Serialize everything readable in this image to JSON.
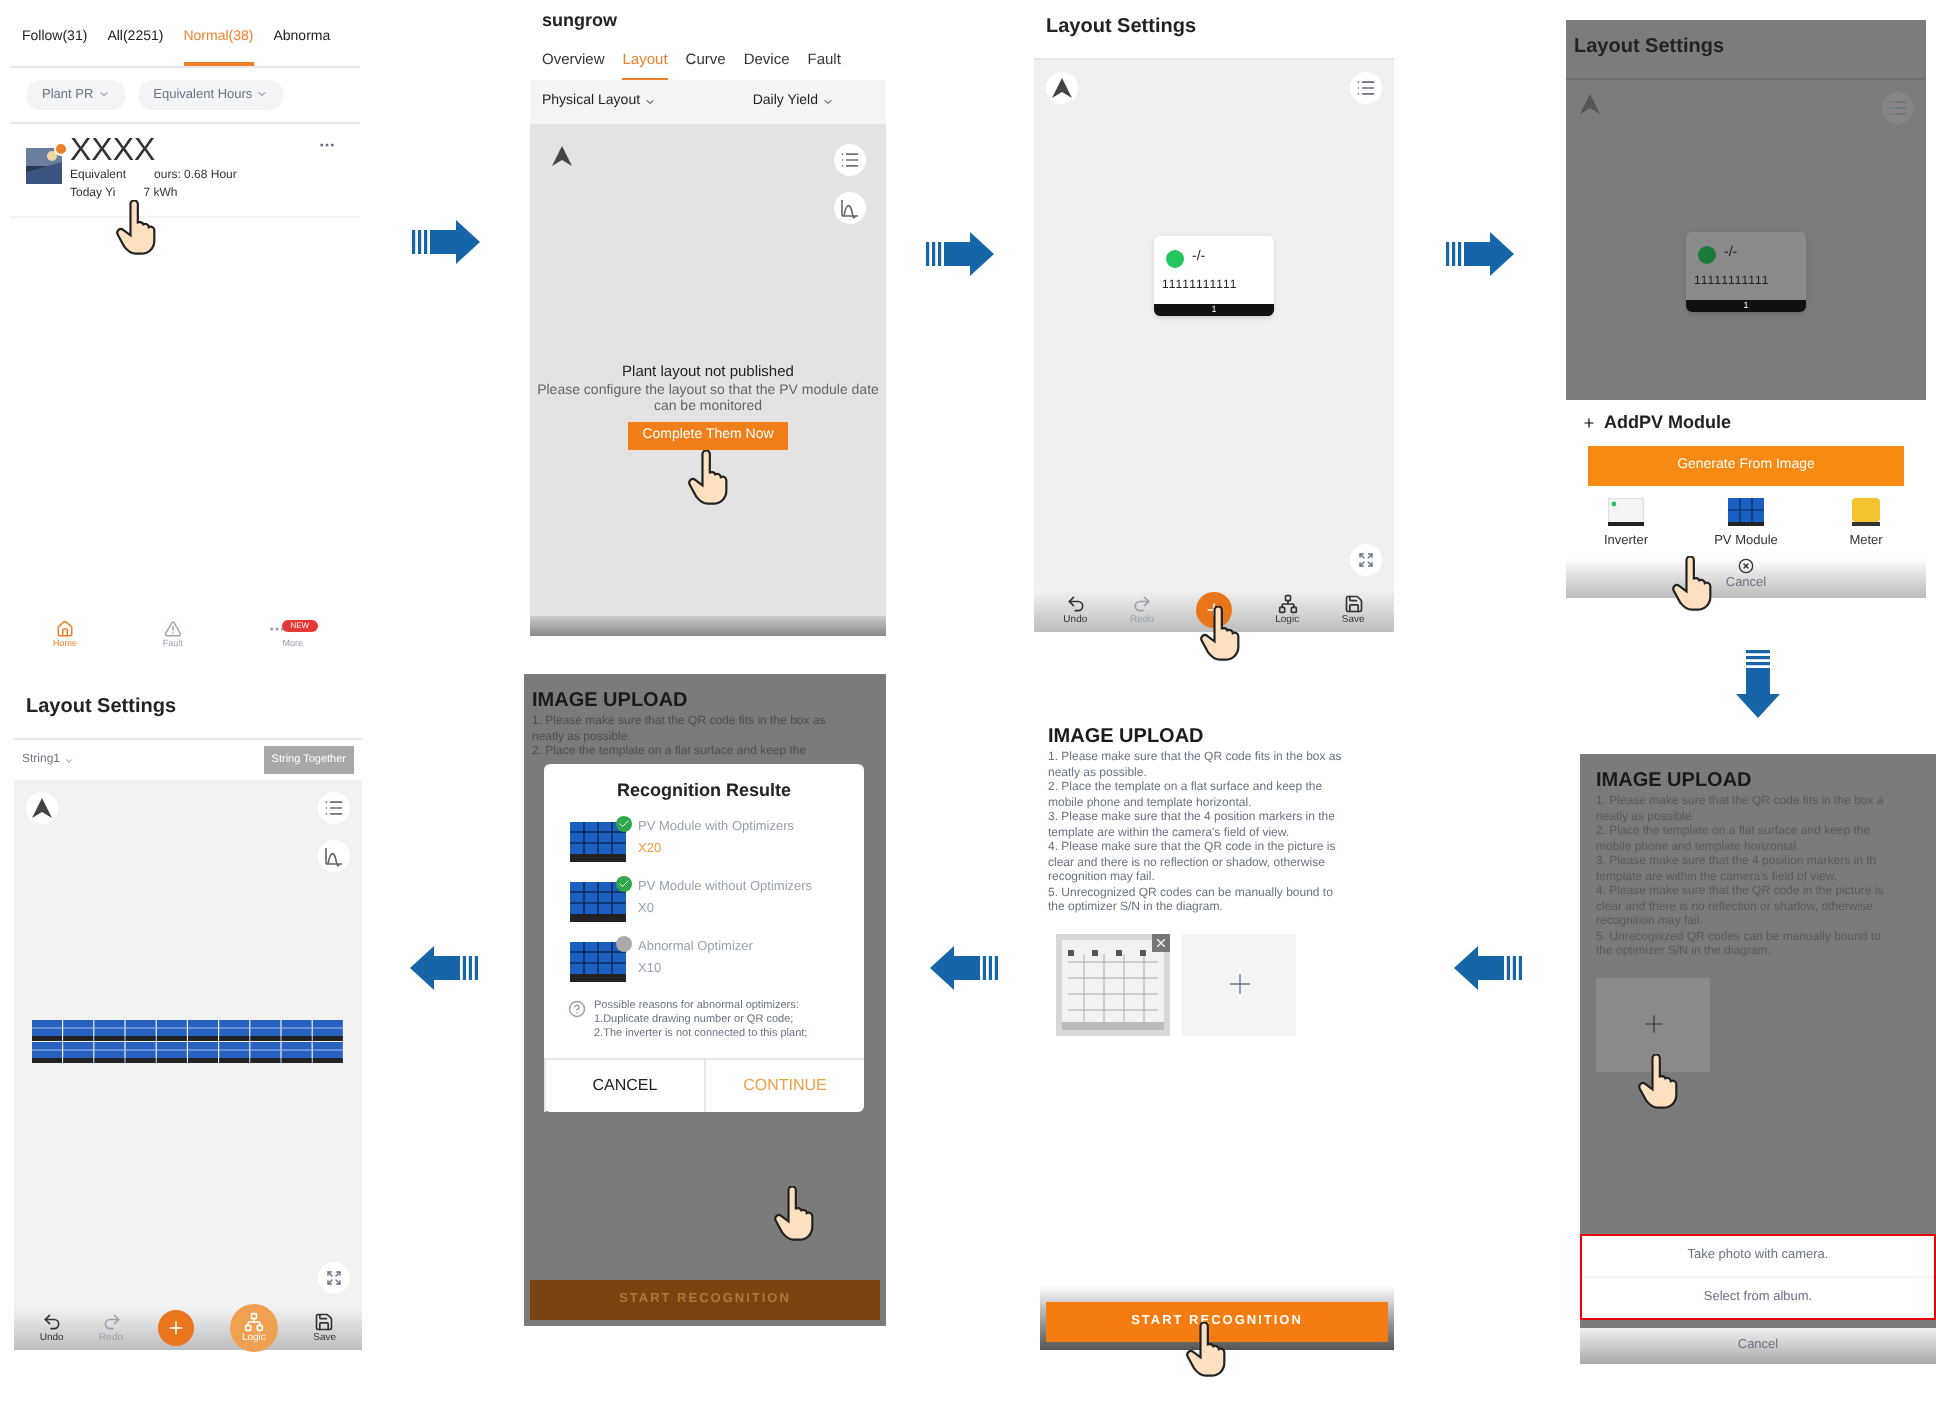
{
  "plant_list_screen": {
    "tabs": [
      {
        "label": "Follow(31)",
        "selected": false
      },
      {
        "label": "All(2251)",
        "selected": false
      },
      {
        "label": "Normal(38)",
        "selected": true
      },
      {
        "label": "Abnorma",
        "selected": false
      }
    ],
    "filters": [
      "Plant PR",
      "Equivalent Hours"
    ],
    "plant": {
      "name": "XXXX",
      "hours_parts": [
        "Equivalent",
        "ours: 0.68 Hour"
      ],
      "yield_parts": [
        "Today Yi",
        "7 kWh"
      ]
    },
    "nav": [
      {
        "kind": "home",
        "label": "Home",
        "selected": true
      },
      {
        "kind": "fault",
        "label": "Fault",
        "selected": false
      },
      {
        "kind": "more",
        "label": "More",
        "selected": false,
        "badge": "NEW"
      }
    ]
  },
  "plant_layout_screen": {
    "brand": "sungrow",
    "tabs": [
      {
        "label": "Overview",
        "selected": false
      },
      {
        "label": "Layout",
        "selected": true
      },
      {
        "label": "Curve",
        "selected": false
      },
      {
        "label": "Device",
        "selected": false
      },
      {
        "label": "Fault",
        "selected": false
      }
    ],
    "dropdowns": [
      "Physical Layout",
      "Daily Yield"
    ],
    "message_title": "Plant layout not published",
    "message_body": "Please configure the layout so that the PV module date can be monitored",
    "action": "Complete Them Now"
  },
  "layout_settings_screen": {
    "title": "Layout Settings",
    "device": {
      "reading": "-/-",
      "serial": "11111111111",
      "index": "1"
    },
    "toolbar": [
      {
        "kind": "undo",
        "label": "Undo",
        "disabled": false,
        "selected": false
      },
      {
        "kind": "redo",
        "label": "Redo",
        "disabled": true,
        "selected": false
      },
      {
        "kind": "add",
        "disabled": false,
        "selected": false
      },
      {
        "kind": "logic",
        "label": "Logic",
        "disabled": false,
        "selected": false
      },
      {
        "kind": "save",
        "label": "Save",
        "disabled": false,
        "selected": false
      }
    ]
  },
  "add_device_screen": {
    "title": "Layout Settings",
    "device": {
      "reading": "-/-",
      "serial": "11111111111",
      "index": "1"
    },
    "sheet_title": "AddPV Module",
    "action": "Generate From Image",
    "devices": [
      {
        "kind": "inverter",
        "label": "Inverter"
      },
      {
        "kind": "pv_module",
        "label": "PV Module"
      },
      {
        "kind": "meter",
        "label": "Meter"
      }
    ],
    "cancel": "Cancel"
  },
  "upload_choice_screen": {
    "title": "IMAGE UPLOAD",
    "instructions": [
      "1. Please make sure that the QR code fits in the box a",
      "neatly as possible.",
      "2. Place the template on a flat surface and keep the",
      "mobile phone and template horizontal.",
      "3. Please make sure that the 4 position markers in th",
      "template are within the camera's field of view.",
      "4. Please make sure that the QR code in the picture is",
      "clear and there is no reflection or shadow, otherwise",
      "recognition may fail.",
      "5. Unrecognized QR codes can be manually bound to",
      "the optimizer S/N in the diagram."
    ],
    "options": [
      "Take photo with camera.",
      "Select from album."
    ],
    "cancel": "Cancel"
  },
  "upload_screen": {
    "title": "IMAGE UPLOAD",
    "instructions": [
      "1. Please make sure that the QR code fits in the box as",
      "neatly as possible.",
      "2. Place the template on a flat surface and keep the",
      "mobile phone and template horizontal.",
      "3. Please make sure that the 4 position markers in the",
      "template are within the camera's field of view.",
      "4. Please make sure that the QR code in the picture is",
      "clear and there is no reflection or shadow, otherwise",
      "recognition may fail.",
      "5. Unrecognized QR codes can be manually bound to",
      "the optimizer S/N in the diagram."
    ],
    "action": "START RECOGNITION"
  },
  "recognition_screen": {
    "title": "IMAGE UPLOAD",
    "instructions": [
      "1. Please make sure that the QR code fits in the box as",
      "neatly as possible.",
      "2. Place the template on a flat surface and keep the"
    ],
    "dialog": {
      "title": "Recognition Resulte",
      "results": [
        {
          "label": "PV Module with Optimizers",
          "count": "X20",
          "kind": "check",
          "highlighted": true
        },
        {
          "label": "PV Module without Optimizers",
          "count": "X0",
          "kind": "check",
          "highlighted": false
        },
        {
          "label": "Abnormal Optimizer",
          "count": "X10",
          "kind": "question",
          "highlighted": false
        }
      ],
      "note": [
        "Possible reasons for abnormal optimizers:",
        "1.Duplicate drawing number or QR code;",
        "2.The inverter is not connected to this plant;"
      ],
      "buttons": [
        {
          "label": "CANCEL",
          "primary": false
        },
        {
          "label": "CONTINUE",
          "primary": true
        }
      ]
    },
    "action": "START RECOGNITION"
  },
  "string_layout_screen": {
    "title": "Layout Settings",
    "string": "String1",
    "action": "String Together",
    "toolbar": [
      {
        "kind": "undo",
        "label": "Undo",
        "disabled": false,
        "selected": false
      },
      {
        "kind": "redo",
        "label": "Redo",
        "disabled": true,
        "selected": false
      },
      {
        "kind": "add",
        "disabled": false,
        "selected": false
      },
      {
        "kind": "logic",
        "label": "Logic",
        "disabled": false,
        "selected": true
      },
      {
        "kind": "save",
        "label": "Save",
        "disabled": false,
        "selected": false
      }
    ]
  }
}
